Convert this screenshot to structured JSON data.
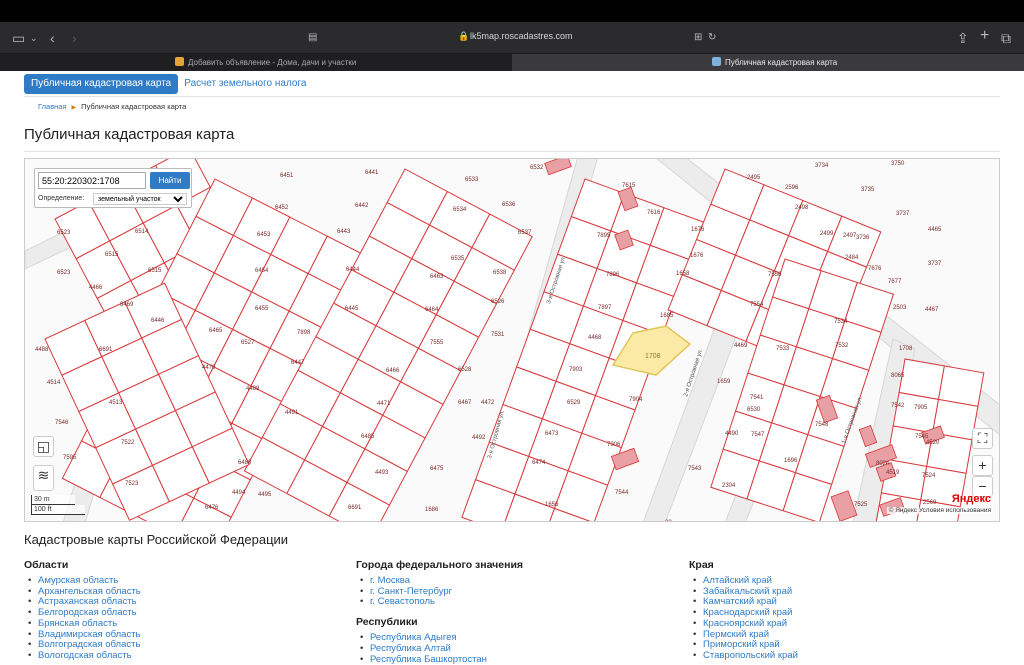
{
  "browser": {
    "url": "lk5map.roscadastres.com",
    "tabs": [
      {
        "title": "Добавить объявление - Дома, дачи и участки",
        "active": false
      },
      {
        "title": "Публичная кадастровая карта",
        "active": true
      }
    ]
  },
  "nav": {
    "primary": "Публичная кадастровая карта",
    "secondary": "Расчет земельного налога"
  },
  "breadcrumb": {
    "home": "Главная",
    "current": "Публичная кадастровая карта"
  },
  "page_title": "Публичная кадастровая карта",
  "map": {
    "search_value": "55:20:220302:1708",
    "search_button": "Найти",
    "definition_label": "Определение:",
    "definition_value": "земельный участок",
    "selected_parcel": "1708",
    "scale_m": "30 m",
    "scale_ft": "100 ft",
    "provider": "Яндекс",
    "copyright": "© Яндекс Условия использования",
    "street_labels": [
      "3-я Островная ул.",
      "2-я Островная ул.",
      "1-я Островная ул.",
      "3-я Островная ул."
    ],
    "parcel_labels": [
      "6451",
      "6441",
      "6533",
      "6532",
      "7615",
      "2495",
      "2596",
      "3734",
      "3750",
      "6452",
      "6442",
      "6534",
      "6536",
      "7616",
      "1676",
      "2498",
      "3735",
      "6523",
      "6514",
      "6453",
      "6443",
      "6535",
      "6537",
      "7895",
      "1676",
      "2499",
      "2497",
      "3736",
      "3737",
      "4465",
      "6523",
      "6515",
      "6454",
      "6444",
      "6463",
      "6538",
      "7896",
      "1658",
      "7556",
      "2484",
      "7676",
      "3737",
      "4466",
      "6515",
      "6455",
      "6445",
      "6464",
      "6526",
      "7897",
      "1685",
      "7554",
      "7677",
      "2503",
      "4467",
      "6469",
      "6446",
      "6465",
      "6527",
      "7898",
      "7555",
      "7531",
      "4468",
      "4469",
      "7533",
      "7534",
      "1708",
      "4488",
      "6691",
      "4470",
      "6447",
      "6466",
      "6528",
      "7903",
      "7532",
      "8065",
      "4514",
      "4489",
      "4471",
      "6467",
      "6529",
      "7904",
      "1659",
      "7541",
      "7542",
      "4513",
      "4491",
      "4472",
      "6473",
      "6530",
      "7905",
      "7546",
      "7522",
      "4490",
      "7547",
      "7548",
      "7545",
      "7595",
      "6485",
      "4492",
      "6474",
      "7906",
      "1696",
      "8024",
      "4520",
      "7523",
      "6488",
      "4493",
      "6475",
      "7543",
      "4519",
      "7524",
      "4494",
      "4495",
      "6476",
      "6691",
      "1686",
      "7544",
      "2304",
      "7525",
      "2569",
      "1656",
      "28"
    ]
  },
  "regions_title": "Кадастровые карты Российской Федерации",
  "columns": [
    {
      "title": "Области",
      "items": [
        "Амурская область",
        "Архангельская область",
        "Астраханская область",
        "Белгородская область",
        "Брянская область",
        "Владимирская область",
        "Волгоградская область",
        "Вологодская область"
      ]
    },
    {
      "title": "Города федерального значения",
      "items": [
        "г. Москва",
        "г. Санкт-Петербург",
        "г. Севастополь"
      ]
    },
    {
      "title": "Республики",
      "items": [
        "Республика Адыгея",
        "Республика Алтай",
        "Республика Башкортостан"
      ]
    },
    {
      "title": "Края",
      "items": [
        "Алтайский край",
        "Забайкальский край",
        "Камчатский край",
        "Краснодарский край",
        "Красноярский край",
        "Пермский край",
        "Приморский край",
        "Ставропольский край"
      ]
    }
  ],
  "colors": {
    "accent": "#2f7bc6",
    "parcel_border": "#d9383a",
    "selected_fill": "#fbe9a6"
  }
}
